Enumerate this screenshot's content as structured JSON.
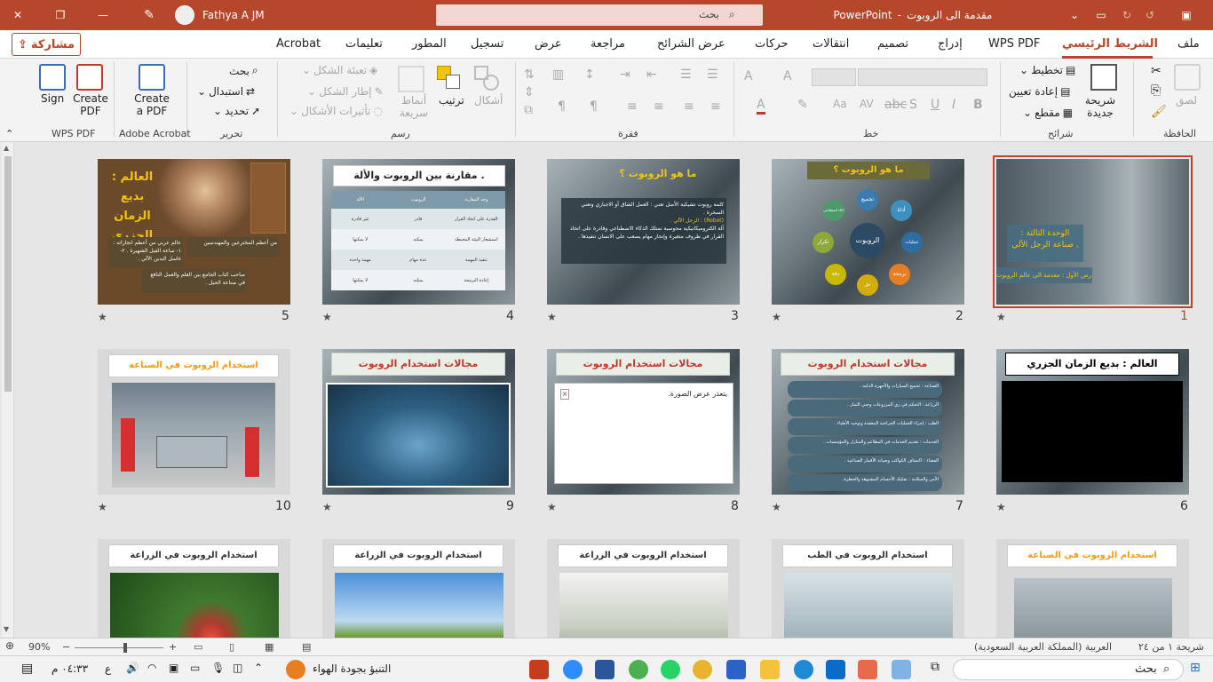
{
  "title_bar": {
    "user": "Fathya A JM",
    "search_placeholder": "بحث",
    "doc_title": "مقدمة الى الروبوت",
    "app": "PowerPoint",
    "title_sep": "-"
  },
  "menu": {
    "share": "مشاركة",
    "tabs": [
      "ملف",
      "الشريط الرئيسي",
      "WPS PDF",
      "إدراج",
      "تصميم",
      "انتقالات",
      "حركات",
      "عرض الشرائح",
      "مراجعة",
      "عرض",
      "تسجيل",
      "المطور",
      "تعليمات",
      "Acrobat"
    ],
    "active": "الشريط الرئيسي"
  },
  "ribbon": {
    "groups": [
      "الحافظة",
      "شرائح",
      "خط",
      "فقرة",
      "رسم",
      "تحرير",
      "Adobe Acrobat",
      "WPS PDF"
    ],
    "paste": "لصق",
    "new_slide": "شريحة جديدة",
    "layout": "تخطيط",
    "reset": "إعادة تعيين",
    "section": "مقطع",
    "shapes": "أشكال",
    "arrange": "ترتيب",
    "quick_styles": "أنماط سريعة",
    "shape_fill": "تعبئة الشكل",
    "shape_outline": "إطار الشكل",
    "shape_effects": "تأثيرات الأشكال",
    "find": "بحث",
    "replace": "استبدال",
    "select": "تحديد",
    "create_a_pdf": "Create a PDF",
    "create_pdf": "Create PDF",
    "sign": "Sign"
  },
  "slides": [
    {
      "n": "1",
      "title": "الوحدة الثالثة : صناعة الرجل الآلي .",
      "subtitle": "الدرس الأول : مقدمة الى عالم الروبوت ."
    },
    {
      "n": "2",
      "title": "ما هو الروبوت ؟",
      "center": "الروبوت",
      "items": [
        "تجميع",
        "أداة",
        "عمليات خطرة",
        "برمجة",
        "حل مشكلات",
        "دقة",
        "تكرار",
        "ذكاء اصطناعي"
      ]
    },
    {
      "n": "3",
      "title": "ما هو الروبوت ؟",
      "p1": "كلمة روبوت تشيكية الأصل تعني : العمل الشاق أو الاجباري وتعني السخرة .",
      "p2": "(Robot) : الرجل الآلي .",
      "p3": "آلة الكتروميكانيكية محوسبة تمتلك الذكاء الاصطناعي وقادرة على اتخاذ القرار في ظروف متغيرة وإنجاز مهام يصعب على الانسان تنفيذها ."
    },
    {
      "n": "4",
      "title": "مقارنة بين الروبوت والألة .",
      "headers": [
        "وجه المقارنة",
        "الروبوت",
        "الألة"
      ],
      "rows": [
        [
          "القدرة على اتخاذ القرار",
          "قادر",
          "غير قادرة"
        ],
        [
          "استشعار البيئة المحيطة",
          "يمكنه",
          "لا يمكنها"
        ],
        [
          "تنفيذ المهمة",
          "عدة مهام",
          "مهمة واحدة"
        ],
        [
          "إعادة البرمجة",
          "يمكنه",
          "لا يمكنها"
        ]
      ]
    },
    {
      "n": "5",
      "title": "العالم : بديع الزمان الجزري",
      "b1": "من أعظم المخترعين والمهندسين",
      "b2": "عالم عربي من أعظم انجازاته :",
      "b3": "١- ساعة الفيل الشهيرة . ٢- غاسل اليدين الآلي .",
      "b4": "صاحب كتاب الجامع بين العلم والعمل النافع في صناعة الحيل ."
    },
    {
      "n": "6",
      "title": "العالم : بديع الزمان الجزري"
    },
    {
      "n": "7",
      "title": "مجالات استخدام الروبوت",
      "rows": [
        "الصناعة : تجميع السيارات والأجهزة الذكية .",
        "الزراعة : التحكم في ري المزروعات وجني الثمار .",
        "الطب : إجراء العمليات الجراحية المعقدة وتوجيه الأطباء .",
        "الخدمات : تقديم الخدمات في المطاعم والمنازل والمؤسسات .",
        "الفضاء : اكتشاف الكواكب وصيانة الأقمار الصناعية .",
        "الأمن والسلامة : تفكيك الأجسام المشبوهة والخطرة ."
      ]
    },
    {
      "n": "8",
      "title": "مجالات استخدام الروبوت",
      "error": "يتعذر عرض الصورة."
    },
    {
      "n": "9",
      "title": "مجالات استخدام الروبوت"
    },
    {
      "n": "10",
      "title": "استخدام الروبوت في الصناعة"
    },
    {
      "n": "11",
      "title": "استخدام الروبوت في الصناعة"
    },
    {
      "n": "12",
      "title": "استخدام الروبوت في الطب"
    },
    {
      "n": "13",
      "title": "استخدام الروبوت في الزراعة"
    },
    {
      "n": "14",
      "title": "استخدام الروبوت في الزراعة"
    },
    {
      "n": "15",
      "title": "استخدام الروبوت في الزراعة"
    }
  ],
  "star": "★",
  "status": {
    "slide_count": "شريحة ١ من ٢٤",
    "language": "العربية (المملكة العربية السعودية)",
    "zoom": "90%"
  },
  "taskbar": {
    "search": "بحث",
    "weather": "التنبؤ بجودة الهواء",
    "time": "٠٤:٣٣ م",
    "lang": "ع"
  },
  "colors": {
    "accent": "#b7472a",
    "slide_bg": "#3f4b52",
    "title_orange": "#c0392b",
    "title_yellow": "#f1c40f"
  }
}
